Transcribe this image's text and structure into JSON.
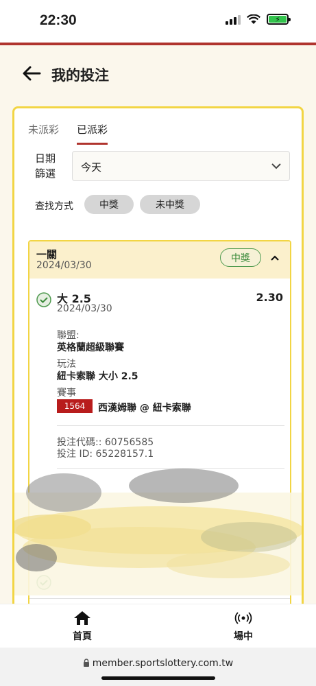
{
  "status": {
    "time": "22:30"
  },
  "header": {
    "title": "我的投注"
  },
  "tabs": [
    {
      "label": "未派彩",
      "active": false
    },
    {
      "label": "已派彩",
      "active": true
    }
  ],
  "filter": {
    "date_label": "日期篩選",
    "date_value": "今天",
    "search_label": "查找方式",
    "chips": [
      "中獎",
      "未中獎"
    ]
  },
  "bet": {
    "type": "一關",
    "date": "2024/03/30",
    "result_badge": "中獎",
    "selection": {
      "name": "大 2.5",
      "date": "2024/03/30",
      "odds": "2.30",
      "league_label": "聯盟:",
      "league": "英格蘭超級聯賽",
      "play_label": "玩法",
      "play": "紐卡索聯 大小 2.5",
      "event_label": "賽事",
      "match_number": "1564",
      "match": "西漢姆聯 @ 紐卡索聯",
      "bet_code": "投注代碼:: 60756585",
      "bet_id": "投注 ID: 65228157.1"
    }
  },
  "nav": {
    "home": "首頁",
    "live": "場中"
  },
  "browser": {
    "url": "member.sportslottery.com.tw"
  },
  "colors": {
    "accent_red": "#b0342e",
    "border_yellow": "#f2d544",
    "win_green": "#3a8a3a"
  }
}
